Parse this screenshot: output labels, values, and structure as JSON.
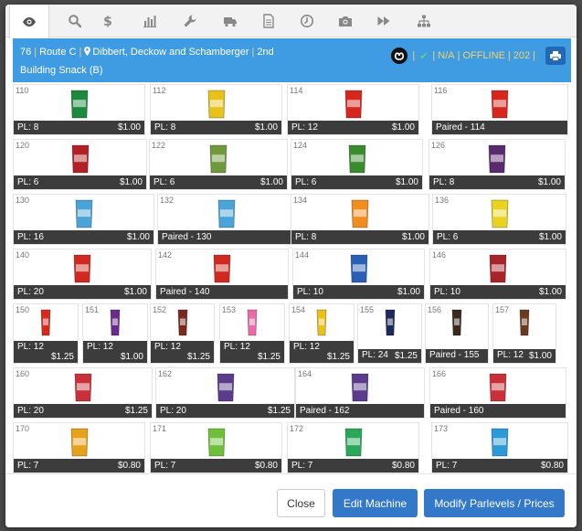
{
  "tabs": [
    "eye-icon",
    "search-icon",
    "dollar-icon",
    "bar-chart-icon",
    "wrench-icon",
    "truck-icon",
    "document-icon",
    "clock-icon",
    "camera-icon",
    "fast-forward-icon",
    "sitemap-icon"
  ],
  "header": {
    "machine_num": "76",
    "route": "Route C",
    "location": "Dibbert, Deckow and Schamberger",
    "floor": "2nd",
    "description": "Building Snack (B)",
    "na": "N/A",
    "status": "OFFLINE",
    "count": "202",
    "accent": "#3f9be2",
    "status_color": "#f3d26d"
  },
  "rows": [
    {
      "slots": [
        {
          "num": "110",
          "pl": "PL: 8",
          "price": "$1.00",
          "color": "#1b8a3d"
        },
        {
          "num": "112",
          "pl": "PL: 8",
          "price": "$1.00",
          "color": "#e8c21a"
        },
        {
          "num": "114",
          "pl": "PL: 12",
          "price": "$1.00",
          "color": "#d7261e"
        },
        {
          "num": "116",
          "pl": "Paired - 114",
          "price": "",
          "color": "#d7261e"
        }
      ]
    },
    {
      "slots": [
        {
          "num": "120",
          "pl": "PL: 6",
          "price": "$1.00",
          "color": "#b31f24"
        },
        {
          "num": "122",
          "pl": "PL: 6",
          "price": "$1.00",
          "color": "#6f9a3b"
        },
        {
          "num": "124",
          "pl": "PL: 6",
          "price": "$1.00",
          "color": "#3a8a2e"
        },
        {
          "num": "126",
          "pl": "PL: 8",
          "price": "$1.00",
          "color": "#5a2a6e"
        }
      ]
    },
    {
      "slots": [
        {
          "num": "130",
          "pl": "PL: 16",
          "price": "$1.00",
          "color": "#4aa4d8"
        },
        {
          "num": "132",
          "pl": "Paired - 130",
          "price": "",
          "color": "#4aa4d8"
        },
        {
          "num": "134",
          "pl": "PL: 8",
          "price": "$1.00",
          "color": "#f28c1c"
        },
        {
          "num": "136",
          "pl": "PL: 6",
          "price": "$1.00",
          "color": "#e8d41e"
        }
      ]
    },
    {
      "slots": [
        {
          "num": "140",
          "pl": "PL: 20",
          "price": "$1.00",
          "color": "#d1281f"
        },
        {
          "num": "142",
          "pl": "Paired - 140",
          "price": "",
          "color": "#d1281f"
        },
        {
          "num": "144",
          "pl": "PL: 10",
          "price": "$1.00",
          "color": "#2a5fb8"
        },
        {
          "num": "146",
          "pl": "PL: 10",
          "price": "$1.00",
          "color": "#a8242a"
        }
      ]
    },
    {
      "slots": [
        {
          "num": "150",
          "pl": "PL: 12",
          "price": "$1.25",
          "color": "#d6291f"
        },
        {
          "num": "151",
          "pl": "PL: 12",
          "price": "$1.00",
          "color": "#6a2c8c"
        },
        {
          "num": "152",
          "pl": "PL: 12",
          "price": "$1.25",
          "color": "#7a2a1e"
        },
        {
          "num": "153",
          "pl": "PL: 12",
          "price": "$1.25",
          "color": "#e86aa6"
        },
        {
          "num": "154",
          "pl": "PL: 12",
          "price": "$1.25",
          "color": "#e8c21a"
        },
        {
          "num": "155",
          "pl": "PL: 24",
          "price": "$1.25",
          "color": "#1d2a5a"
        },
        {
          "num": "156",
          "pl": "Paired - 155",
          "price": "",
          "color": "#3a2a1e"
        },
        {
          "num": "157",
          "pl": "PL: 12",
          "price": "$1.00",
          "color": "#6a3a1e"
        }
      ]
    },
    {
      "slots": [
        {
          "num": "160",
          "pl": "PL: 20",
          "price": "$1.25",
          "color": "#c8313a"
        },
        {
          "num": "162",
          "pl": "PL: 20",
          "price": "$1.25",
          "color": "#5a3c8a"
        },
        {
          "num": "164",
          "pl": "Paired - 162",
          "price": "",
          "color": "#5a3c8a"
        },
        {
          "num": "166",
          "pl": "Paired - 160",
          "price": "",
          "color": "#c8313a"
        }
      ]
    },
    {
      "slots": [
        {
          "num": "170",
          "pl": "PL: 7",
          "price": "$0.80",
          "color": "#e8a21a"
        },
        {
          "num": "171",
          "pl": "PL: 7",
          "price": "$0.80",
          "color": "#6fbf3a"
        },
        {
          "num": "172",
          "pl": "PL: 7",
          "price": "$0.80",
          "color": "#2aa85a"
        },
        {
          "num": "173",
          "pl": "PL: 7",
          "price": "$0.80",
          "color": "#2a9ad8"
        }
      ]
    }
  ],
  "footer": {
    "close": "Close",
    "edit": "Edit Machine",
    "modify": "Modify Parlevels / Prices",
    "button_color": "#3378c9"
  }
}
